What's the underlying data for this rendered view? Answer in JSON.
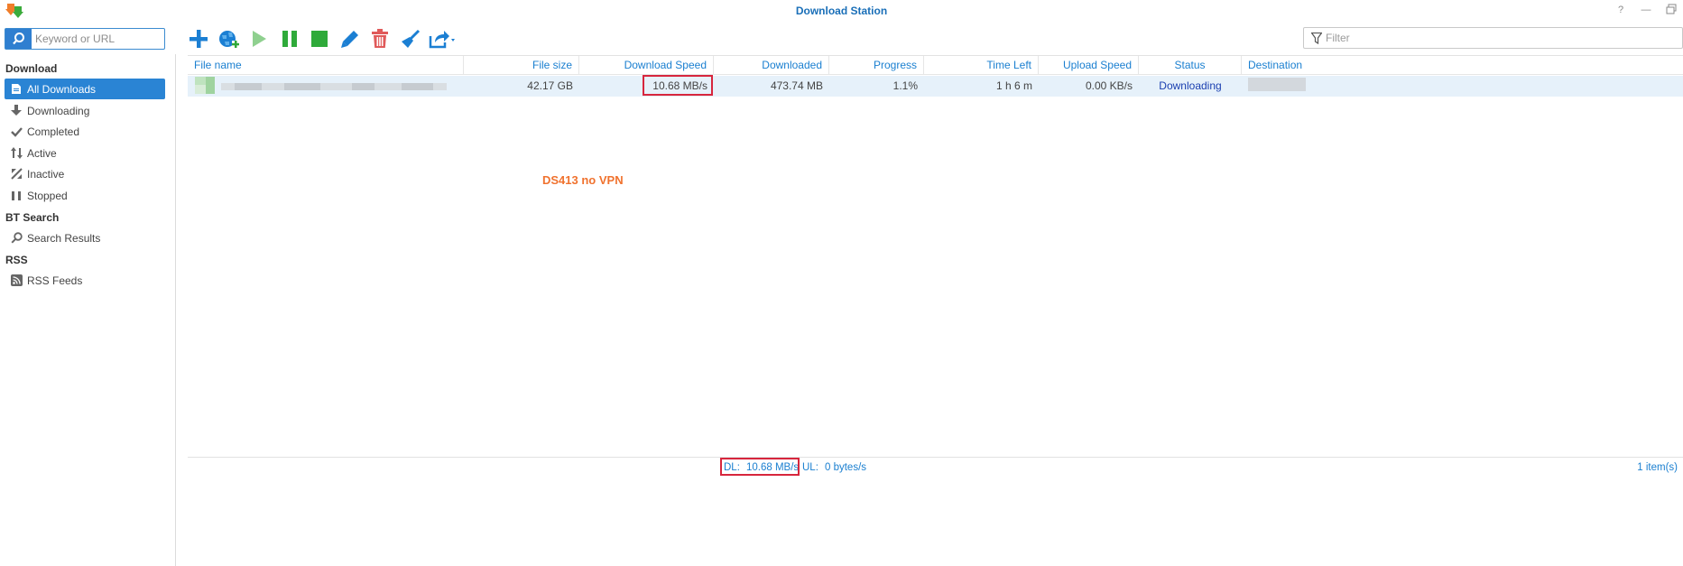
{
  "window": {
    "title": "Download Station"
  },
  "search": {
    "placeholder": "Keyword or URL"
  },
  "filter": {
    "placeholder": "Filter"
  },
  "sidebar": {
    "sections": [
      {
        "title": "Download",
        "items": [
          "All Downloads",
          "Downloading",
          "Completed",
          "Active",
          "Inactive",
          "Stopped"
        ]
      },
      {
        "title": "BT Search",
        "items": [
          "Search Results"
        ]
      },
      {
        "title": "RSS",
        "items": [
          "RSS Feeds"
        ]
      }
    ],
    "selected": "All Downloads"
  },
  "toolbar": {
    "icons": [
      "plus-icon",
      "globe-add-icon",
      "play-icon",
      "pause-icon",
      "stop-icon",
      "pencil-icon",
      "trash-icon",
      "broom-icon",
      "share-icon"
    ]
  },
  "grid": {
    "columns": [
      "File name",
      "File size",
      "Download Speed",
      "Downloaded",
      "Progress",
      "Time Left",
      "Upload Speed",
      "Status",
      "Destination"
    ],
    "rows": [
      {
        "file_size": "42.17 GB",
        "download_speed": "10.68 MB/s",
        "downloaded": "473.74 MB",
        "progress": "1.1%",
        "time_left": "1 h 6 m",
        "upload_speed": "0.00 KB/s",
        "status": "Downloading"
      }
    ]
  },
  "annotation": {
    "text": "DS413 no VPN",
    "color": "#f0722e"
  },
  "statusbar": {
    "dl_label": "DL:",
    "dl_value": "10.68 MB/s",
    "ul_label": "UL:",
    "ul_value": "0 bytes/s",
    "items": "1 item(s)"
  },
  "colors": {
    "accent": "#2a84d4",
    "highlight_box": "#d7263d",
    "link": "#1a7fd0"
  }
}
